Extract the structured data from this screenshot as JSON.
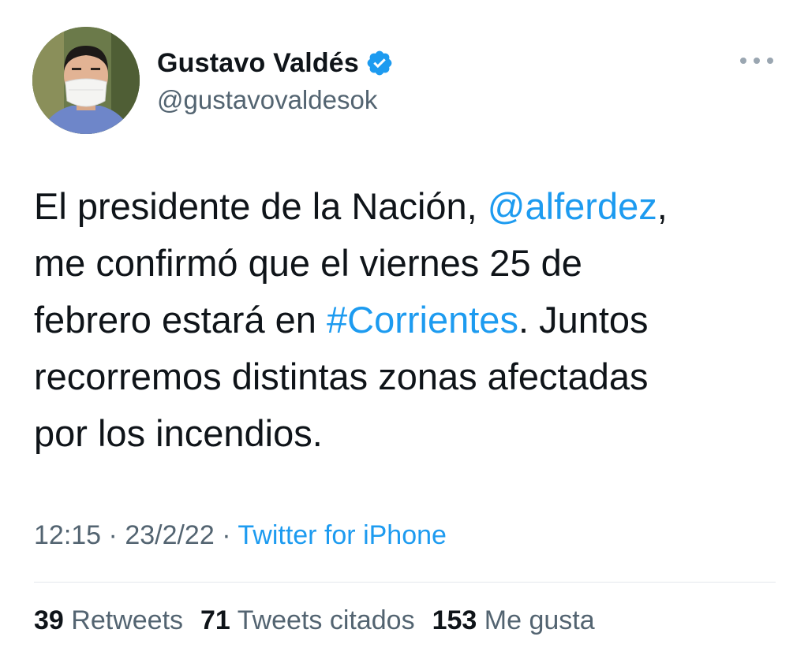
{
  "author": {
    "display_name": "Gustavo Valdés",
    "handle": "@gustavovaldesok",
    "verified": true,
    "avatar_icon": "profile-photo-masked-man"
  },
  "more_icon": "more-horizontal-icon",
  "tweet": {
    "lines": [
      [
        "El presidente de la Nación, ",
        "@alferdez",
        ","
      ],
      [
        "me confirmó que el viernes 25 de"
      ],
      [
        "febrero estará en ",
        "#Corrientes",
        ". Juntos"
      ],
      [
        "recorremos distintas zonas afectadas"
      ],
      [
        "por los incendios."
      ]
    ]
  },
  "meta": {
    "time": "12:15",
    "separator": " · ",
    "date": "23/2/22",
    "source": "Twitter for iPhone"
  },
  "stats": {
    "retweets_count": "39",
    "retweets_label": "Retweets",
    "quotes_count": "71",
    "quotes_label": "Tweets citados",
    "likes_count": "153",
    "likes_label": "Me gusta"
  },
  "colors": {
    "link": "#1d9bf0",
    "secondary_text": "#536471",
    "primary_text": "#0f1419"
  }
}
